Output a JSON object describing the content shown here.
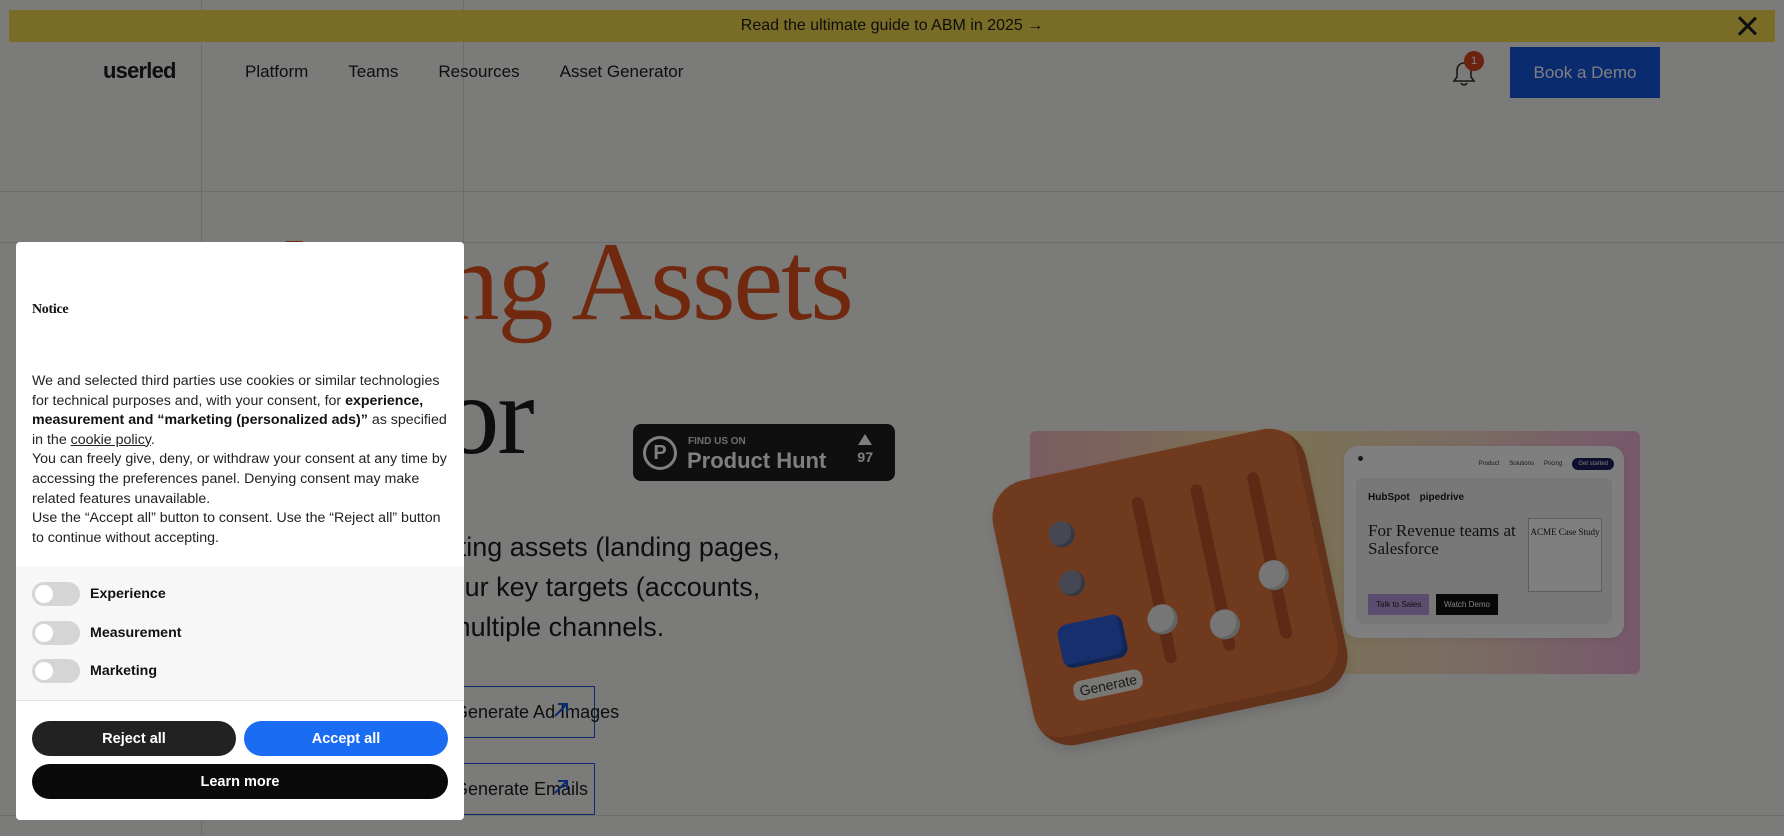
{
  "announcement": {
    "text": "Read the ultimate guide to ABM in 2025 →"
  },
  "nav": {
    "logo": "userled",
    "items": [
      "Platform",
      "Teams",
      "Resources",
      "Asset Generator"
    ],
    "notification_count": "1",
    "demo_button": "Book a Demo"
  },
  "hero": {
    "title_line1": "Marketing Assets",
    "title_line2": "Generator",
    "product_hunt": {
      "small": "FIND US ON",
      "big": "Product Hunt",
      "votes": "97"
    },
    "description_lines": [
      "Generate personalized marketing assets (landing pages,",
      "ad images...) in minutes for your key targets (accounts,",
      "personas, industries) across multiple channels."
    ],
    "cta_1": "Generate Ad Images",
    "cta_2": "Generate Emails"
  },
  "illustration": {
    "mock_nav": [
      "Product",
      "Solutions",
      "Pricing",
      "Get started"
    ],
    "mock_logos": [
      "HubSpot",
      "pipedrive"
    ],
    "mock_headline": "For Revenue teams at Salesforce",
    "mock_case": "ACME Case Study",
    "mock_btn1": "Talk to Sales",
    "mock_btn2": "Watch Demo",
    "generate_label": "Generate"
  },
  "cookie_notice": {
    "title": "Notice",
    "para1_a": "We and selected third parties use cookies or similar technologies for technical purposes and, with your consent, for ",
    "para1_bold": "experience, measurement and “marketing (personalized ads)”",
    "para1_b": " as specified in the ",
    "para1_link": "cookie policy",
    "para1_c": ".",
    "para2": "You can freely give, deny, or withdraw your consent at any time by accessing the preferences panel. Denying consent may make related features unavailable.",
    "para3": "Use the “Accept all” button to consent. Use the “Reject all” button to continue without accepting.",
    "preferences": [
      "Experience",
      "Measurement",
      "Marketing"
    ],
    "reject_label": "Reject all",
    "accept_label": "Accept all",
    "learn_label": "Learn more"
  },
  "colors": {
    "accent_orange": "#e0521c",
    "brand_blue": "#1456e0",
    "accept_blue": "#1a6cf2",
    "announce_yellow": "#f0d84c"
  }
}
